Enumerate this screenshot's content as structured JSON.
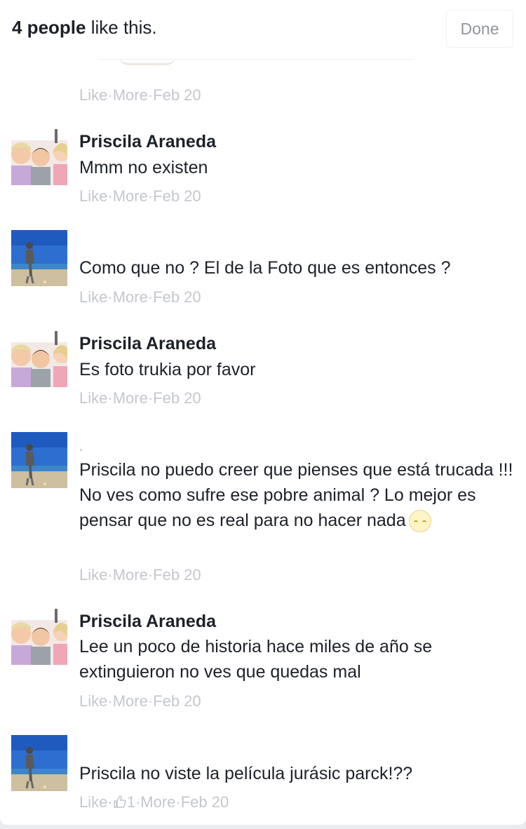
{
  "header": {
    "likes_count": "4 people",
    "likes_suffix": " like this.",
    "done_label": "Done"
  },
  "meta_labels": {
    "like": "Like",
    "more": "More",
    "sep": " · "
  },
  "comments": [
    {
      "author": "",
      "text": "",
      "date": "Feb 20",
      "avatar": "kids-photo-avatar"
    },
    {
      "author": "Priscila Araneda",
      "text": "Mmm no existen",
      "date": "Feb 20",
      "avatar": "kids-photo-avatar"
    },
    {
      "author": "",
      "text": "Como que no ? El de la Foto que es entonces ?",
      "date": "Feb 20",
      "avatar": "beach-photo-avatar"
    },
    {
      "author": "Priscila Araneda",
      "text": "Es foto trukia por favor",
      "date": "Feb 20",
      "avatar": "kids-photo-avatar"
    },
    {
      "author": "",
      "text": "Priscila no puedo creer que pienses que está trucada !!! No ves como sufre ese pobre animal ? Lo mejor es pensar que no es real para no hacer nada",
      "date": "Feb 20",
      "avatar": "beach-photo-avatar",
      "emoji": "disappointed-face"
    },
    {
      "author": "Priscila Araneda",
      "text": "Lee un poco de historia hace miles de año se extinguieron no ves que quedas mal",
      "date": "Feb 20",
      "avatar": "kids-photo-avatar"
    },
    {
      "author": "",
      "text": "Priscila no viste la película jurásic parck!??",
      "date": "Feb 20",
      "avatar": "beach-photo-avatar",
      "reaction_count": "1"
    }
  ]
}
